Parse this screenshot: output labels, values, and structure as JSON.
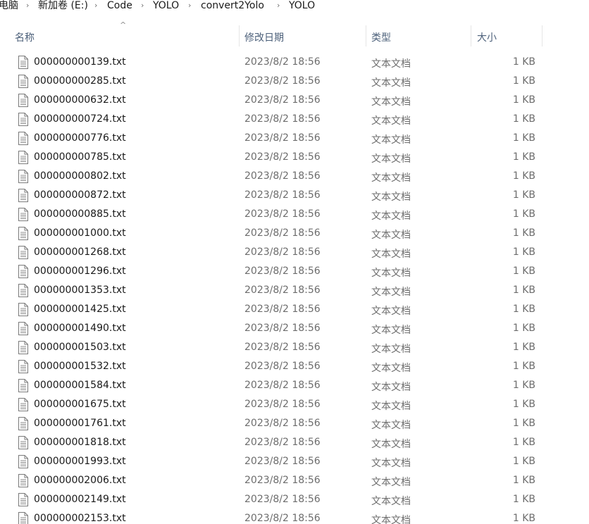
{
  "breadcrumb": [
    {
      "label": "电脑"
    },
    {
      "label": "新加卷 (E:)"
    },
    {
      "label": "Code"
    },
    {
      "label": "YOLO"
    },
    {
      "label": "convert2Yolo"
    },
    {
      "label": "YOLO"
    }
  ],
  "breadcrumb_separator": "›",
  "columns": {
    "name": "名称",
    "date": "修改日期",
    "type": "类型",
    "size": "大小",
    "sort_indicator": "^"
  },
  "files": [
    {
      "name": "000000000139.txt",
      "date": "2023/8/2 18:56",
      "type": "文本文档",
      "size": "1 KB"
    },
    {
      "name": "000000000285.txt",
      "date": "2023/8/2 18:56",
      "type": "文本文档",
      "size": "1 KB"
    },
    {
      "name": "000000000632.txt",
      "date": "2023/8/2 18:56",
      "type": "文本文档",
      "size": "1 KB"
    },
    {
      "name": "000000000724.txt",
      "date": "2023/8/2 18:56",
      "type": "文本文档",
      "size": "1 KB"
    },
    {
      "name": "000000000776.txt",
      "date": "2023/8/2 18:56",
      "type": "文本文档",
      "size": "1 KB"
    },
    {
      "name": "000000000785.txt",
      "date": "2023/8/2 18:56",
      "type": "文本文档",
      "size": "1 KB"
    },
    {
      "name": "000000000802.txt",
      "date": "2023/8/2 18:56",
      "type": "文本文档",
      "size": "1 KB"
    },
    {
      "name": "000000000872.txt",
      "date": "2023/8/2 18:56",
      "type": "文本文档",
      "size": "1 KB"
    },
    {
      "name": "000000000885.txt",
      "date": "2023/8/2 18:56",
      "type": "文本文档",
      "size": "1 KB"
    },
    {
      "name": "000000001000.txt",
      "date": "2023/8/2 18:56",
      "type": "文本文档",
      "size": "1 KB"
    },
    {
      "name": "000000001268.txt",
      "date": "2023/8/2 18:56",
      "type": "文本文档",
      "size": "1 KB"
    },
    {
      "name": "000000001296.txt",
      "date": "2023/8/2 18:56",
      "type": "文本文档",
      "size": "1 KB"
    },
    {
      "name": "000000001353.txt",
      "date": "2023/8/2 18:56",
      "type": "文本文档",
      "size": "1 KB"
    },
    {
      "name": "000000001425.txt",
      "date": "2023/8/2 18:56",
      "type": "文本文档",
      "size": "1 KB"
    },
    {
      "name": "000000001490.txt",
      "date": "2023/8/2 18:56",
      "type": "文本文档",
      "size": "1 KB"
    },
    {
      "name": "000000001503.txt",
      "date": "2023/8/2 18:56",
      "type": "文本文档",
      "size": "1 KB"
    },
    {
      "name": "000000001532.txt",
      "date": "2023/8/2 18:56",
      "type": "文本文档",
      "size": "1 KB"
    },
    {
      "name": "000000001584.txt",
      "date": "2023/8/2 18:56",
      "type": "文本文档",
      "size": "1 KB"
    },
    {
      "name": "000000001675.txt",
      "date": "2023/8/2 18:56",
      "type": "文本文档",
      "size": "1 KB"
    },
    {
      "name": "000000001761.txt",
      "date": "2023/8/2 18:56",
      "type": "文本文档",
      "size": "1 KB"
    },
    {
      "name": "000000001818.txt",
      "date": "2023/8/2 18:56",
      "type": "文本文档",
      "size": "1 KB"
    },
    {
      "name": "000000001993.txt",
      "date": "2023/8/2 18:56",
      "type": "文本文档",
      "size": "1 KB"
    },
    {
      "name": "000000002006.txt",
      "date": "2023/8/2 18:56",
      "type": "文本文档",
      "size": "1 KB"
    },
    {
      "name": "000000002149.txt",
      "date": "2023/8/2 18:56",
      "type": "文本文档",
      "size": "1 KB"
    },
    {
      "name": "000000002153.txt",
      "date": "2023/8/2 18:56",
      "type": "文本文档",
      "size": "1 KB"
    }
  ],
  "file_icon": "text-file-icon",
  "colors": {
    "header_text": "#4c607a",
    "secondary_text": "#6d6d6d",
    "divider": "#e5e5e5"
  }
}
